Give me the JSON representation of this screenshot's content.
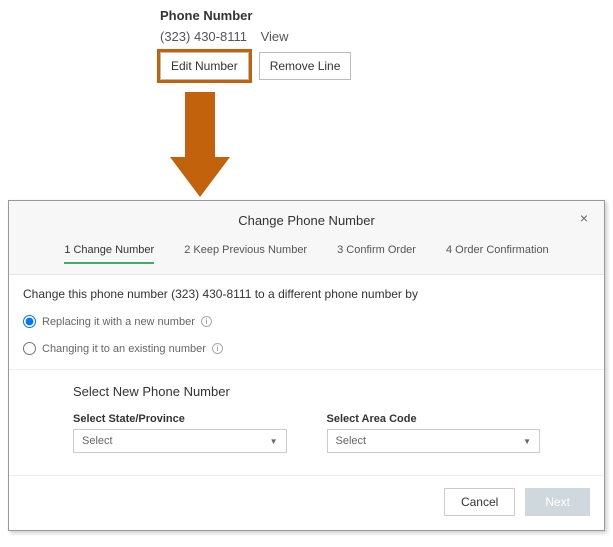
{
  "top": {
    "title": "Phone Number",
    "phone": "(323) 430-8111",
    "view": "View",
    "edit": "Edit Number",
    "remove": "Remove Line"
  },
  "dialog": {
    "title": "Change Phone Number",
    "close": "×",
    "steps": [
      "1  Change Number",
      "2  Keep Previous Number",
      "3  Confirm Order",
      "4  Order Confirmation"
    ],
    "prompt": "Change this phone number (323) 430-8111 to a different phone number by",
    "option_replace": "Replacing it with a new number",
    "option_existing": "Changing it to an existing number",
    "section_title": "Select New Phone Number",
    "state_label": "Select State/Province",
    "state_value": "Select",
    "area_label": "Select Area Code",
    "area_value": "Select",
    "cancel": "Cancel",
    "next": "Next"
  }
}
